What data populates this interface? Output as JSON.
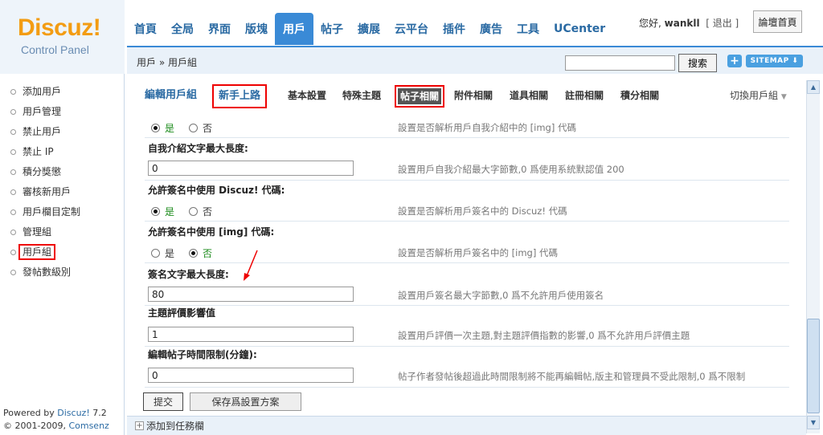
{
  "logo": {
    "brand": "Discuz!",
    "subtitle": "Control Panel"
  },
  "topnav": [
    {
      "label": "首頁"
    },
    {
      "label": "全局"
    },
    {
      "label": "界面"
    },
    {
      "label": "版塊"
    },
    {
      "label": "用戶",
      "active": true
    },
    {
      "label": "帖子"
    },
    {
      "label": "擴展"
    },
    {
      "label": "云平台"
    },
    {
      "label": "插件"
    },
    {
      "label": "廣告"
    },
    {
      "label": "工具"
    },
    {
      "label": "UCenter"
    }
  ],
  "user": {
    "greeting": "您好,",
    "name": "wankll",
    "logout": "[ 退出 ]"
  },
  "forum_home": "論壇首頁",
  "breadcrumb": "用戶 » 用戶組",
  "search": {
    "value": "",
    "button": "搜索"
  },
  "toolbar": {
    "plus": "+",
    "sitemap": "SITEMAP ⬇"
  },
  "sidebar": {
    "items": [
      {
        "label": "添加用戶"
      },
      {
        "label": "用戶管理"
      },
      {
        "label": "禁止用戶"
      },
      {
        "label": "禁止 IP"
      },
      {
        "label": "積分獎懲"
      },
      {
        "label": "審核新用戶"
      },
      {
        "label": "用戶欄目定制"
      },
      {
        "label": "管理組"
      },
      {
        "label": "用戶組",
        "active": true
      },
      {
        "label": "發帖數級別"
      }
    ],
    "powered_prefix": "Powered by ",
    "powered_product": "Discuz!",
    "powered_version": " 7.2",
    "copyright_prefix": "© 2001-2009, ",
    "copyright_company": "Comsenz Inc."
  },
  "tabs": {
    "title": "編輯用戶組",
    "newbie": "新手上路",
    "basic": "基本設置",
    "special": "特殊主題",
    "posts": "帖子相關",
    "attach": "附件相關",
    "magic": "道具相關",
    "trade": "註冊相關",
    "credits": "積分相關",
    "switch": "切換用戶組"
  },
  "form": {
    "row0": {
      "yes": "是",
      "no": "否",
      "desc": "設置是否解析用戶自我介紹中的 [img] 代碼"
    },
    "row1": {
      "label": "自我介紹文字最大長度:",
      "value": "0",
      "desc": "設置用戶自我介紹最大字節數,0 爲使用系統默認值 200"
    },
    "row2": {
      "label": "允許簽名中使用 Discuz! 代碼:",
      "yes": "是",
      "no": "否",
      "desc": "設置是否解析用戶簽名中的 Discuz! 代碼"
    },
    "row3": {
      "label": "允許簽名中使用 [img] 代碼:",
      "yes": "是",
      "no": "否",
      "desc": "設置是否解析用戶簽名中的 [img] 代碼"
    },
    "row4": {
      "label": "簽名文字最大長度:",
      "value": "80",
      "desc": "設置用戶簽名最大字節數,0 爲不允許用戶使用簽名"
    },
    "row5": {
      "label": "主題評價影響值",
      "value": "1",
      "desc": "設置用戶評價一次主題,對主題評價指數的影響,0 爲不允許用戶評價主題"
    },
    "row6": {
      "label": "編輯帖子時間限制(分鐘):",
      "value": "0",
      "desc": "帖子作者發帖後超過此時間限制將不能再編輯帖,版主和管理員不受此限制,0 爲不限制"
    }
  },
  "buttons": {
    "submit": "提交",
    "save_scheme": "保存爲設置方案"
  },
  "footer": {
    "add_task": "添加到任務欄"
  },
  "colors": {
    "accent": "#3a8ad6",
    "highlight": "#e00000",
    "logo": "#f39c12"
  }
}
